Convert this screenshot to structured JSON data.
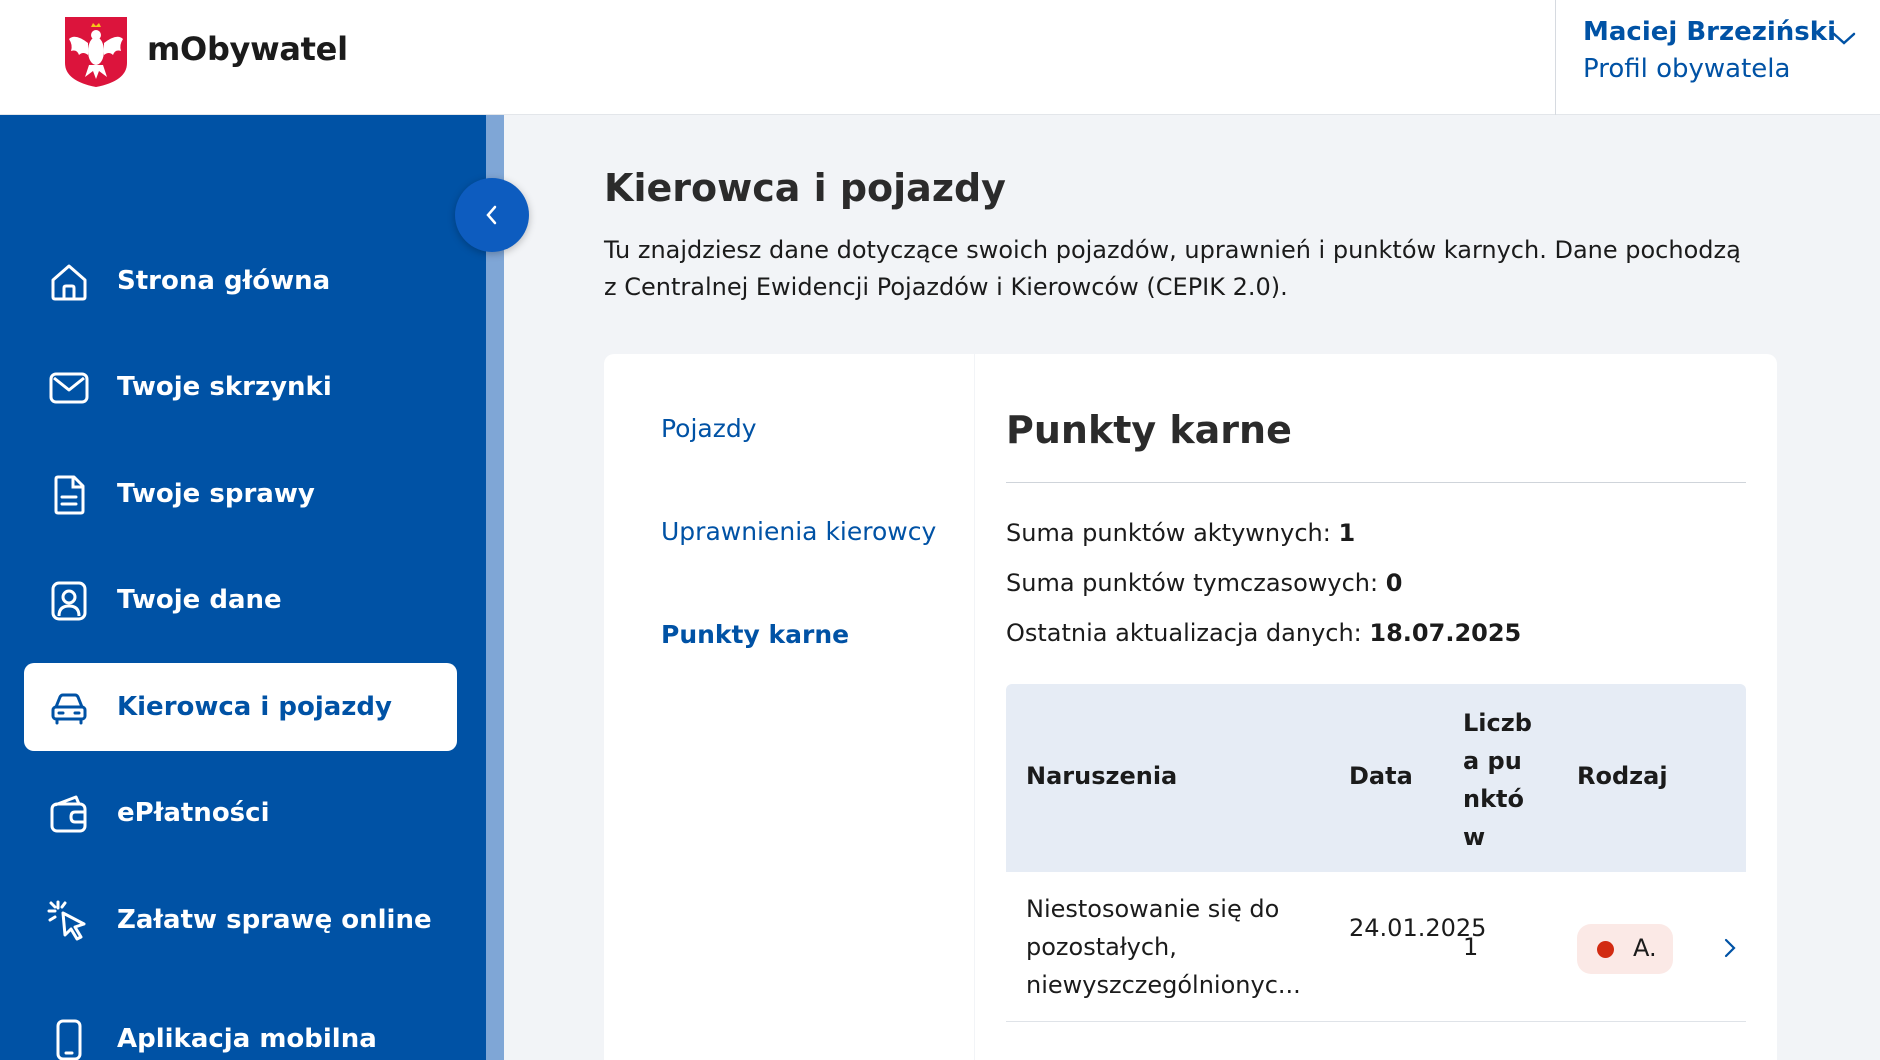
{
  "colors": {
    "brand_blue": "#0052a5",
    "sidebar_bg": "#0052a5",
    "table_header_bg": "#e6ecf5",
    "badge_red": "#d22b12"
  },
  "header": {
    "app_name": "mObywatel",
    "user_name": "Maciej Brzeziński",
    "user_role": "Profil obywatela",
    "logo_icon": "polish-eagle-emblem",
    "dropdown_icon": "chevron-down-icon"
  },
  "sidebar": {
    "collapse_icon": "chevron-left-icon",
    "items": [
      {
        "label": "Strona główna",
        "icon": "home-icon",
        "active": false
      },
      {
        "label": "Twoje skrzynki",
        "icon": "envelope-icon",
        "active": false
      },
      {
        "label": "Twoje sprawy",
        "icon": "document-icon",
        "active": false
      },
      {
        "label": "Twoje dane",
        "icon": "person-card-icon",
        "active": false
      },
      {
        "label": "Kierowca i pojazdy",
        "icon": "car-icon",
        "active": true
      },
      {
        "label": "ePłatności",
        "icon": "wallet-icon",
        "active": false
      },
      {
        "label": "Załatw sprawę online",
        "icon": "cursor-click-icon",
        "active": false
      },
      {
        "label": "Aplikacja mobilna",
        "icon": "smartphone-icon",
        "active": false
      }
    ]
  },
  "main": {
    "title": "Kierowca i pojazdy",
    "description": "Tu znajdziesz dane dotyczące swoich pojazdów, uprawnień i punktów karnych. Dane pochodzą z Centralnej Ewidencji Pojazdów i Kierowców (CEPIK 2.0).",
    "tabs": [
      {
        "label": "Pojazdy",
        "active": false
      },
      {
        "label": "Uprawnienia kierowcy",
        "active": false
      },
      {
        "label": "Punkty karne",
        "active": true
      }
    ],
    "section": {
      "title": "Punkty karne",
      "stats": [
        {
          "label": "Suma punktów aktywnych:",
          "value": "1"
        },
        {
          "label": "Suma punktów tymczasowych:",
          "value": "0"
        },
        {
          "label": "Ostatnia aktualizacja danych:",
          "value": "18.07.2025"
        }
      ],
      "table": {
        "columns": [
          "Naruszenia",
          "Data",
          "Liczba punktów",
          "Rodzaj"
        ],
        "rows": [
          {
            "violation": "Niestosowanie się do pozostałych, niewyszczególnionyc...",
            "date": "24.01.2025",
            "points": "1",
            "type": "A.",
            "action_icon": "chevron-right-icon"
          }
        ]
      }
    }
  }
}
